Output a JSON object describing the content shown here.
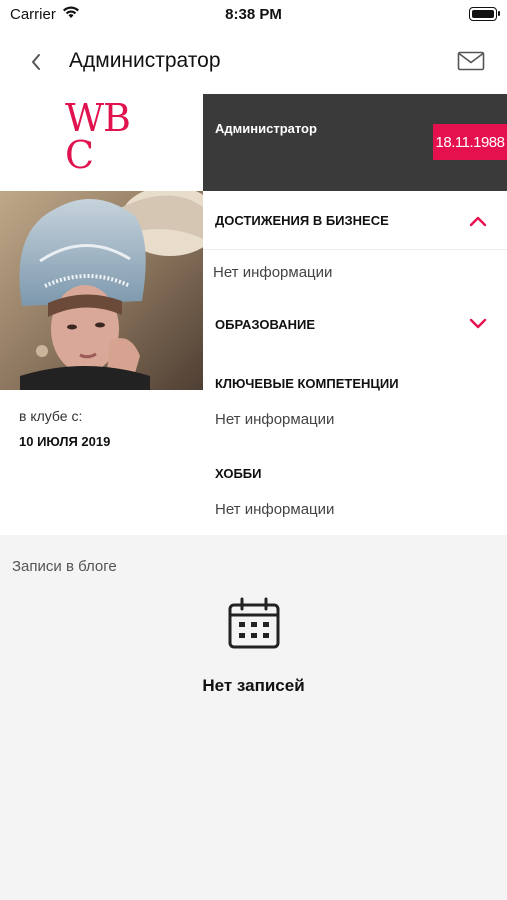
{
  "status_bar": {
    "carrier": "Carrier",
    "time": "8:38 PM"
  },
  "nav": {
    "title": "Администратор",
    "back_icon": "chevron-left-icon",
    "mail_icon": "mail-icon"
  },
  "profile": {
    "logo_lines": [
      "WB",
      "C"
    ],
    "name": "Администратор",
    "birth_date": "18.11.1988",
    "club_label": "в клубе с:",
    "club_date": "10 ИЮЛЯ 2019"
  },
  "sections": [
    {
      "title": "ДОСТИЖЕНИЯ В БИЗНЕСЕ",
      "text": "Нет информации",
      "expanded": true
    },
    {
      "title": "ОБРАЗОВАНИЕ",
      "text": "",
      "expanded": false
    },
    {
      "title": "КЛЮЧЕВЫЕ КОМПЕТЕНЦИИ",
      "text": "Нет информации"
    },
    {
      "title": "ХОББИ",
      "text": "Нет информации"
    }
  ],
  "blog": {
    "label": "Записи в блоге",
    "empty_text": "Нет записей",
    "empty_icon": "calendar-icon"
  },
  "colors": {
    "accent": "#e5114e",
    "header_bg": "#3a3a3b",
    "page_bg": "#f4f4f4"
  }
}
